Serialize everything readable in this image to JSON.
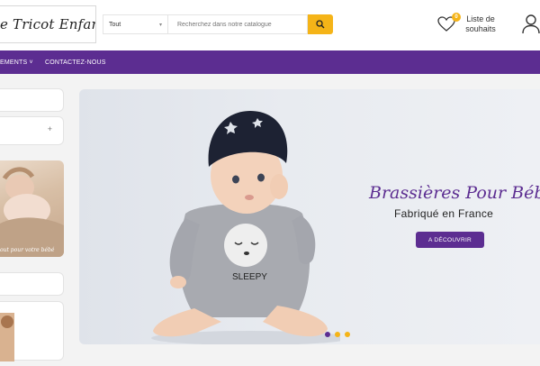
{
  "header": {
    "logo_text": "ette Tricot Enfant",
    "search": {
      "category": "Tout",
      "placeholder": "Recherchez dans notre catalogue"
    },
    "wishlist": {
      "count": "0",
      "label": "Liste de souhaits"
    }
  },
  "nav": {
    "items": [
      {
        "label": "EMENTS ˅"
      },
      {
        "label": "CONTACTEZ-NOUS"
      }
    ]
  },
  "sidebar": {
    "thumb_caption": "out pour votre bébé"
  },
  "hero": {
    "title": "Brassières Pour Bébé",
    "subtitle": "Fabriqué en France",
    "button": "A DÉCOUVRIR",
    "dots": [
      {
        "color": "#5c2d91",
        "active": true
      },
      {
        "color": "#f5b418",
        "active": false
      },
      {
        "color": "#f5b418",
        "active": false
      }
    ]
  },
  "colors": {
    "brand_purple": "#5c2d91",
    "accent_yellow": "#f5b418"
  }
}
